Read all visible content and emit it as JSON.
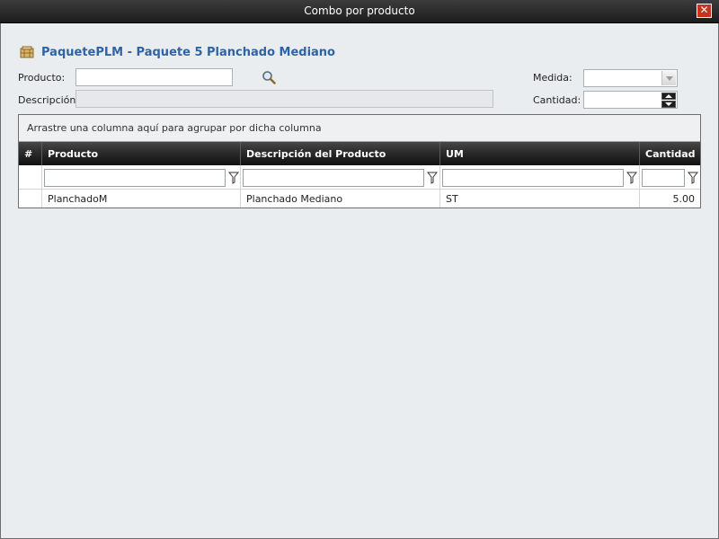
{
  "window": {
    "title": "Combo por producto",
    "close_symbol": "✕"
  },
  "heading": {
    "text": "PaquetePLM - Paquete 5 Planchado Mediano",
    "icon": "package-icon"
  },
  "form": {
    "producto_label": "Producto:",
    "producto_value": "",
    "descripcion_label": "Descripción:",
    "descripcion_value": "",
    "medida_label": "Medida:",
    "medida_value": "",
    "cantidad_label": "Cantidad:",
    "cantidad_value": ""
  },
  "grid": {
    "group_panel_text": "Arrastre una columna aquí para agrupar por dicha columna",
    "columns": [
      "#",
      "Producto",
      "Descripción del Producto",
      "UM",
      "Cantidad"
    ],
    "rows": [
      {
        "num": "",
        "producto": "PlanchadoM",
        "descripcion": "Planchado Mediano",
        "um": "ST",
        "cantidad": "5.00"
      }
    ]
  },
  "colors": {
    "heading": "#2e63a6",
    "titlebar": "#2b2b2b",
    "close": "#c8321e",
    "background": "#e9edf0"
  }
}
